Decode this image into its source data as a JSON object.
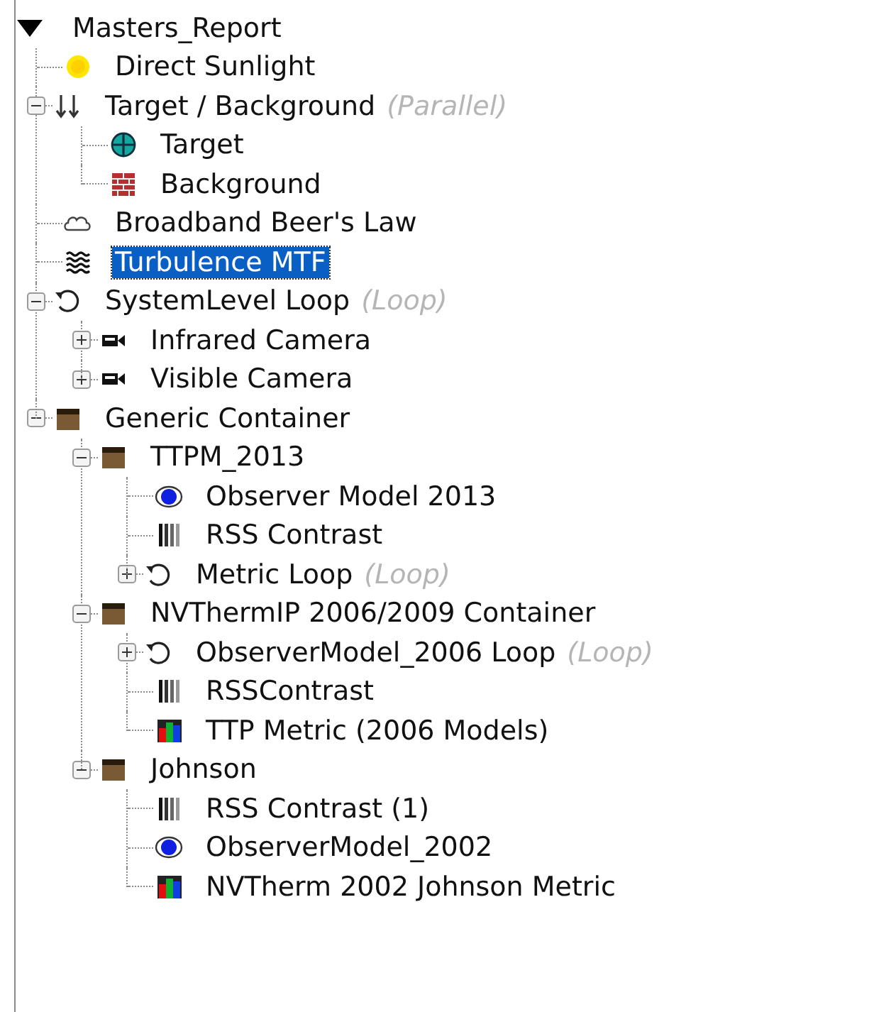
{
  "tree": {
    "label": "Masters_Report",
    "expanded": true,
    "selected": false,
    "children": [
      {
        "kind": "sun",
        "label": "Direct Sunlight",
        "selected": false
      },
      {
        "kind": "parallel",
        "label": "Target / Background",
        "note": "(Parallel)",
        "expanded": true,
        "selected": false,
        "children": [
          {
            "kind": "target",
            "label": "Target",
            "selected": false
          },
          {
            "kind": "brick",
            "label": "Background",
            "selected": false
          }
        ]
      },
      {
        "kind": "cloud",
        "label": "Broadband Beer's Law",
        "selected": false
      },
      {
        "kind": "waves",
        "label": "Turbulence MTF",
        "selected": true
      },
      {
        "kind": "loop",
        "label": "SystemLevel Loop",
        "note": "(Loop)",
        "expanded": true,
        "selected": false,
        "children": [
          {
            "kind": "camera",
            "label": "Infrared Camera",
            "expanded": false,
            "selected": false
          },
          {
            "kind": "camera",
            "label": "Visible Camera",
            "expanded": false,
            "selected": false
          }
        ]
      },
      {
        "kind": "container",
        "label": "Generic Container",
        "expanded": true,
        "selected": false,
        "children": [
          {
            "kind": "container",
            "label": "TTPM_2013",
            "expanded": true,
            "selected": false,
            "children": [
              {
                "kind": "eye",
                "label": "Observer Model 2013",
                "selected": false
              },
              {
                "kind": "stripes",
                "label": "RSS Contrast",
                "selected": false
              },
              {
                "kind": "loop",
                "label": "Metric Loop",
                "note": "(Loop)",
                "expanded": false,
                "selected": false
              }
            ]
          },
          {
            "kind": "container",
            "label": "NVThermIP 2006/2009 Container",
            "expanded": true,
            "selected": false,
            "children": [
              {
                "kind": "loop",
                "label": "ObserverModel_2006 Loop",
                "note": "(Loop)",
                "expanded": false,
                "selected": false
              },
              {
                "kind": "stripes",
                "label": "RSSContrast",
                "selected": false
              },
              {
                "kind": "chart",
                "label": "TTP Metric (2006 Models)",
                "selected": false
              }
            ]
          },
          {
            "kind": "container",
            "label": "Johnson",
            "expanded": true,
            "selected": false,
            "children": [
              {
                "kind": "stripes",
                "label": "RSS Contrast (1)",
                "selected": false
              },
              {
                "kind": "eye",
                "label": "ObserverModel_2002",
                "selected": false
              },
              {
                "kind": "chart",
                "label": "NVTherm 2002 Johnson Metric",
                "selected": false
              }
            ]
          }
        ]
      }
    ]
  }
}
